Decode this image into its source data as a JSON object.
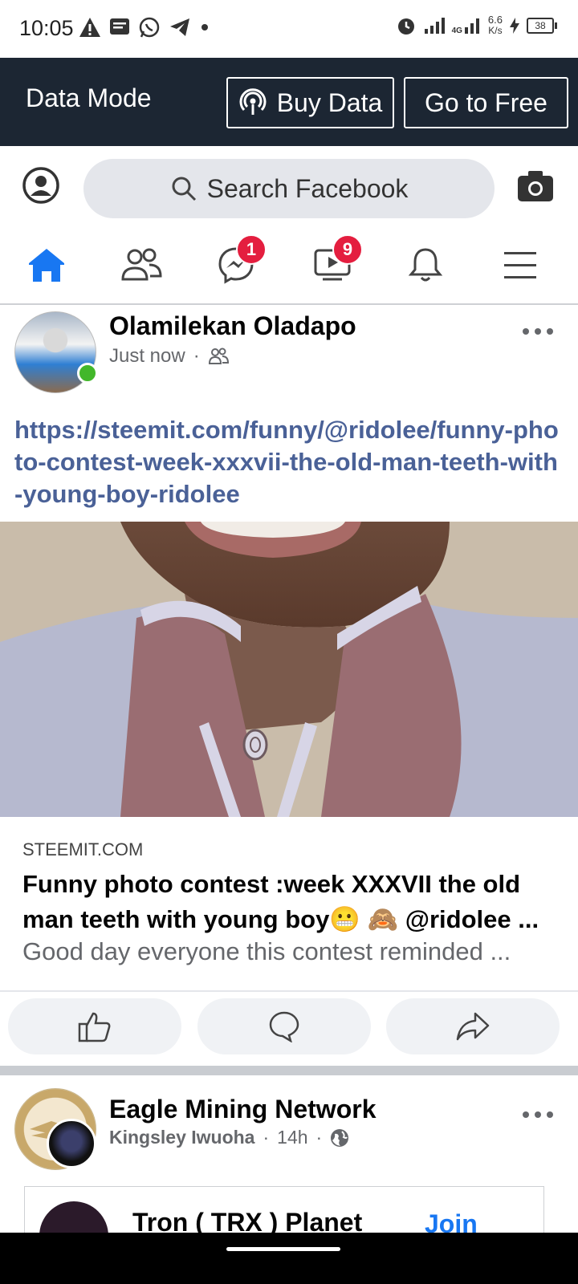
{
  "status_bar": {
    "time": "10:05",
    "network_type": "4G",
    "speed_value": "6.6",
    "speed_unit": "K/s",
    "battery": "38"
  },
  "data_bar": {
    "label": "Data Mode",
    "buy_data": "Buy Data",
    "go_to_free": "Go to Free"
  },
  "search": {
    "placeholder": "Search Facebook"
  },
  "tabs": {
    "messenger_badge": "1",
    "watch_badge": "9"
  },
  "post": {
    "author": "Olamilekan Oladapo",
    "time": "Just now",
    "link_text": "https://steemit.com/funny/@ridolee/funny-photo-contest-week-xxxvii-the-old-man-teeth-with-young-boy-ridolee",
    "card": {
      "domain": "STEEMIT.COM",
      "title": "Funny photo contest :week XXXVII the old man teeth with young boy😬 🙈 @ridolee ...",
      "description": "Good day everyone this contest reminded ..."
    }
  },
  "post2": {
    "group": "Eagle Mining Network",
    "author": "Kingsley Iwuoha",
    "time": "14h",
    "card_name": "Tron ( TRX ) Planet",
    "join": "Join"
  },
  "colors": {
    "facebook_blue": "#1877f2",
    "badge_red": "#e41e3f",
    "data_bar_bg": "#1c2633",
    "link_blue": "#4a6197",
    "online_green": "#42b72a"
  }
}
